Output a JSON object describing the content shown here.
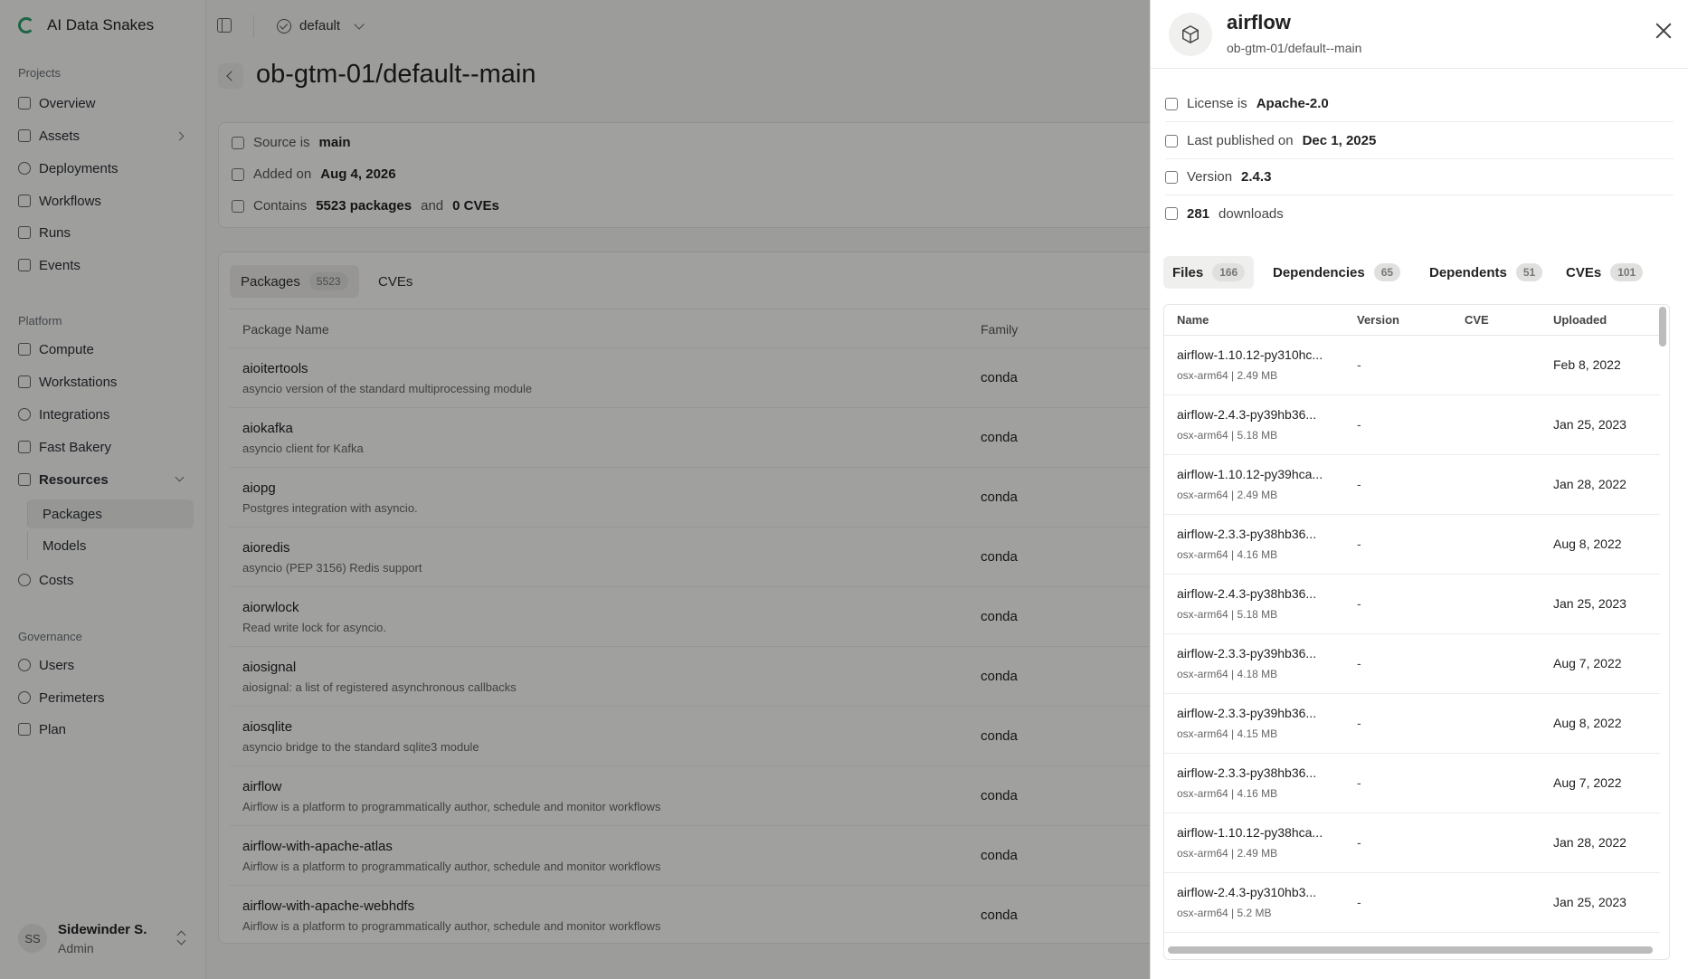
{
  "app": {
    "name": "AI Data Snakes",
    "workspace": "default"
  },
  "sidebar": {
    "sections": [
      {
        "label": "Projects",
        "items": [
          {
            "label": "Overview",
            "icon": "home-icon"
          },
          {
            "label": "Assets",
            "icon": "pencil-icon"
          },
          {
            "label": "Deployments",
            "icon": "target-icon"
          },
          {
            "label": "Workflows",
            "icon": "flow-icon"
          },
          {
            "label": "Runs",
            "icon": "play-icon"
          },
          {
            "label": "Events",
            "icon": "trigger-icon"
          }
        ]
      },
      {
        "label": "Platform",
        "items": [
          {
            "label": "Compute",
            "icon": "server-icon"
          },
          {
            "label": "Workstations",
            "icon": "workstation-icon"
          },
          {
            "label": "Integrations",
            "icon": "integration-icon"
          },
          {
            "label": "Fast Bakery",
            "icon": "bakery-icon"
          },
          {
            "label": "Resources",
            "icon": "warehouse-icon"
          }
        ]
      },
      {
        "label": "Governance",
        "items": [
          {
            "label": "Users",
            "icon": "users-icon"
          },
          {
            "label": "Perimeters",
            "icon": "perimeter-icon"
          },
          {
            "label": "Plan",
            "icon": "plan-icon"
          }
        ]
      }
    ],
    "resources_children": [
      "Packages",
      "Models"
    ],
    "costs_label": "Costs",
    "user": {
      "initials": "SS",
      "name": "Sidewinder S.",
      "role": "Admin"
    }
  },
  "main": {
    "title": "ob-gtm-01/default--main",
    "info": {
      "source_prefix": "Source is",
      "source": "main",
      "added_prefix": "Added on",
      "added": "Aug 4, 2026",
      "contains_prefix": "Contains",
      "packages": "5523 packages",
      "and": "and",
      "cves": "0 CVEs"
    },
    "tabs": [
      {
        "label": "Packages",
        "count": "5523"
      },
      {
        "label": "CVEs"
      }
    ],
    "columns": [
      "Package Name",
      "Family"
    ],
    "rows": [
      {
        "name": "aioitertools",
        "desc": "asyncio version of the standard multiprocessing module",
        "family": "conda"
      },
      {
        "name": "aiokafka",
        "desc": "asyncio client for Kafka",
        "family": "conda"
      },
      {
        "name": "aiopg",
        "desc": "Postgres integration with asyncio.",
        "family": "conda"
      },
      {
        "name": "aioredis",
        "desc": "asyncio (PEP 3156) Redis support",
        "family": "conda"
      },
      {
        "name": "aiorwlock",
        "desc": "Read write lock for asyncio.",
        "family": "conda"
      },
      {
        "name": "aiosignal",
        "desc": "aiosignal: a list of registered asynchronous callbacks",
        "family": "conda"
      },
      {
        "name": "aiosqlite",
        "desc": "asyncio bridge to the standard sqlite3 module",
        "family": "conda"
      },
      {
        "name": "airflow",
        "desc": "Airflow is a platform to programmatically author, schedule and monitor workflows",
        "family": "conda"
      },
      {
        "name": "airflow-with-apache-atlas",
        "desc": "Airflow is a platform to programmatically author, schedule and monitor workflows",
        "family": "conda"
      },
      {
        "name": "airflow-with-apache-webhdfs",
        "desc": "Airflow is a platform to programmatically author, schedule and monitor workflows",
        "family": "conda"
      }
    ]
  },
  "drawer": {
    "title": "airflow",
    "subtitle": "ob-gtm-01/default--main",
    "license_prefix": "License is",
    "license": "Apache-2.0",
    "published_prefix": "Last published on",
    "published": "Dec 1, 2025",
    "version_prefix": "Version",
    "version": "2.4.3",
    "downloads": "281",
    "downloads_suffix": "downloads",
    "tabs": [
      {
        "label": "Files",
        "count": "166"
      },
      {
        "label": "Dependencies",
        "count": "65"
      },
      {
        "label": "Dependents",
        "count": "51"
      },
      {
        "label": "CVEs",
        "count": "101"
      }
    ],
    "columns": [
      "Name",
      "Version",
      "CVE",
      "Uploaded"
    ],
    "files": [
      {
        "name": "airflow-1.10.12-py310hc...",
        "meta": "osx-arm64 | 2.49 MB",
        "version": "-",
        "uploaded": "Feb 8, 2022"
      },
      {
        "name": "airflow-2.4.3-py39hb36...",
        "meta": "osx-arm64 | 5.18 MB",
        "version": "-",
        "uploaded": "Jan 25, 2023"
      },
      {
        "name": "airflow-1.10.12-py39hca...",
        "meta": "osx-arm64 | 2.49 MB",
        "version": "-",
        "uploaded": "Jan 28, 2022"
      },
      {
        "name": "airflow-2.3.3-py38hb36...",
        "meta": "osx-arm64 | 4.16 MB",
        "version": "-",
        "uploaded": "Aug 8, 2022"
      },
      {
        "name": "airflow-2.4.3-py38hb36...",
        "meta": "osx-arm64 | 5.18 MB",
        "version": "-",
        "uploaded": "Jan 25, 2023"
      },
      {
        "name": "airflow-2.3.3-py39hb36...",
        "meta": "osx-arm64 | 4.18 MB",
        "version": "-",
        "uploaded": "Aug 7, 2022"
      },
      {
        "name": "airflow-2.3.3-py39hb36...",
        "meta": "osx-arm64 | 4.15 MB",
        "version": "-",
        "uploaded": "Aug 8, 2022"
      },
      {
        "name": "airflow-2.3.3-py38hb36...",
        "meta": "osx-arm64 | 4.16 MB",
        "version": "-",
        "uploaded": "Aug 7, 2022"
      },
      {
        "name": "airflow-1.10.12-py38hca...",
        "meta": "osx-arm64 | 2.49 MB",
        "version": "-",
        "uploaded": "Jan 28, 2022"
      },
      {
        "name": "airflow-2.4.3-py310hb3...",
        "meta": "osx-arm64 | 5.2 MB",
        "version": "-",
        "uploaded": "Jan 25, 2023"
      }
    ]
  }
}
